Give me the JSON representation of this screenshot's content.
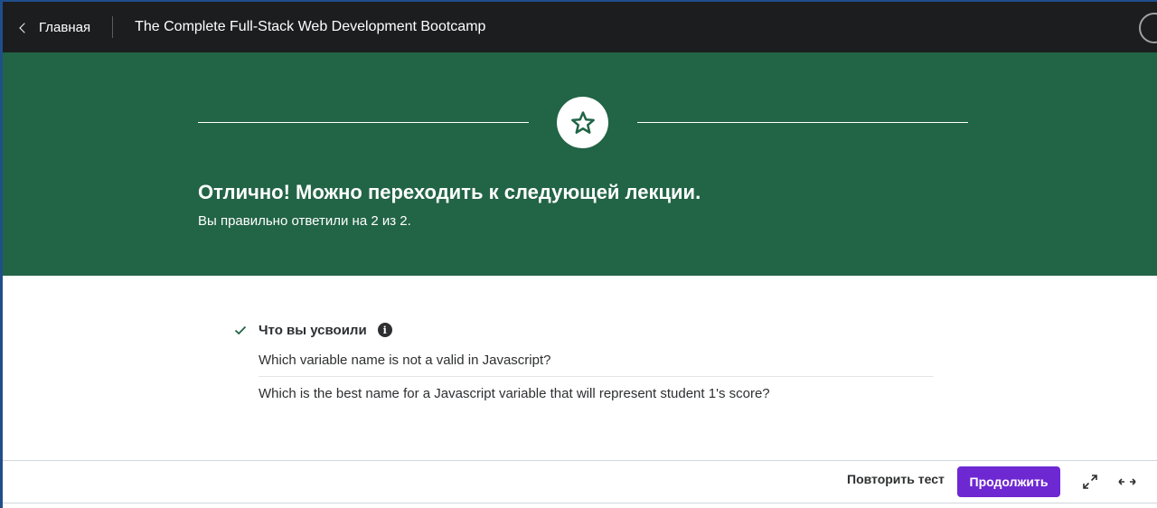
{
  "header": {
    "back_label": "Главная",
    "course_title": "The Complete Full-Stack Web Development Bootcamp"
  },
  "hero": {
    "title": "Отлично! Можно переходить к следующей лекции.",
    "subtitle": "Вы правильно ответили на 2 из 2.",
    "icon": "star-icon",
    "background": "#226446"
  },
  "learned": {
    "title": "Что вы усвоили",
    "info_glyph": "i",
    "questions": [
      "Which variable name is not a valid in Javascript?",
      "Which is the best name for a Javascript variable that will represent student 1's score?"
    ]
  },
  "footer": {
    "retry_label": "Повторить тест",
    "continue_label": "Продолжить",
    "accent": "#6d28d2"
  }
}
